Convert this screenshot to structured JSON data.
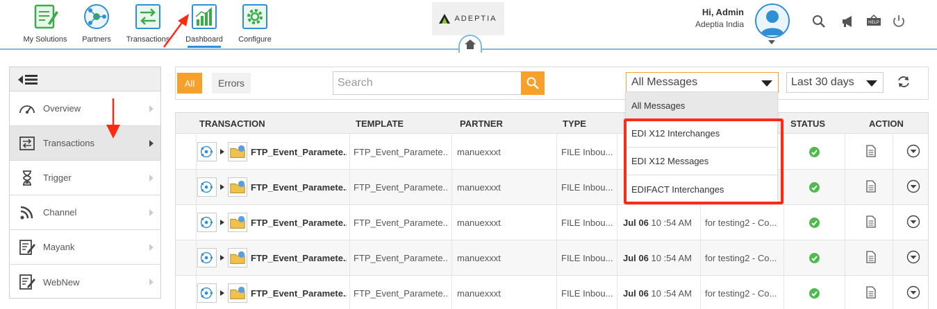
{
  "nav": {
    "items": [
      {
        "label": "My Solutions",
        "icon": "my-solutions-icon"
      },
      {
        "label": "Partners",
        "icon": "partners-icon"
      },
      {
        "label": "Transactions",
        "icon": "transactions-icon"
      },
      {
        "label": "Dashboard",
        "icon": "dashboard-icon"
      },
      {
        "label": "Configure",
        "icon": "configure-icon"
      }
    ],
    "active": "Dashboard"
  },
  "logo": {
    "text": "ADEPTIA"
  },
  "user": {
    "greeting": "Hi, Admin",
    "org": "Adeptia India"
  },
  "sidebar": {
    "items": [
      {
        "label": "Overview",
        "icon": "gauge-icon"
      },
      {
        "label": "Transactions",
        "icon": "transactions-icon"
      },
      {
        "label": "Trigger",
        "icon": "hourglass-icon"
      },
      {
        "label": "Channel",
        "icon": "rss-icon"
      },
      {
        "label": "Mayank",
        "icon": "edit-doc-icon"
      },
      {
        "label": "WebNew",
        "icon": "edit-doc-icon"
      }
    ],
    "active": "Transactions"
  },
  "filters": {
    "all_label": "All",
    "errors_label": "Errors",
    "search_placeholder": "Search",
    "message_select": "All Messages",
    "period_select": "Last 30 days"
  },
  "dropdown": {
    "items": [
      "All Messages",
      "EDI X12 Interchanges",
      "EDI X12 Messages",
      "EDIFACT Interchanges"
    ],
    "selected": "All Messages"
  },
  "table": {
    "headers": [
      "TRANSACTION",
      "TEMPLATE",
      "PARTNER",
      "TYPE",
      "",
      "",
      "STATUS",
      "ACTION"
    ],
    "rows": [
      {
        "transaction": "FTP_Event_Paramete...",
        "template": "FTP_Event_Paramete...",
        "partner": "manuexxxt",
        "type": "FILE Inbou...",
        "date_bold": "",
        "date_rest": "",
        "desc": ""
      },
      {
        "transaction": "FTP_Event_Paramete...",
        "template": "FTP_Event_Paramete...",
        "partner": "manuexxxt",
        "type": "FILE Inbou...",
        "date_bold": "",
        "date_rest": "",
        "desc": ""
      },
      {
        "transaction": "FTP_Event_Paramete...",
        "template": "FTP_Event_Paramete...",
        "partner": "manuexxxt",
        "type": "FILE Inbou...",
        "date_bold": "Jul 06",
        "date_rest": " 10 :54 AM",
        "desc": "for testing2 - Co..."
      },
      {
        "transaction": "FTP_Event_Paramete...",
        "template": "FTP_Event_Paramete...",
        "partner": "manuexxxt",
        "type": "FILE Inbou...",
        "date_bold": "Jul 06",
        "date_rest": " 10 :54 AM",
        "desc": "for testing2 - Co..."
      },
      {
        "transaction": "FTP_Event_Paramete...",
        "template": "FTP_Event_Paramete...",
        "partner": "manuexxxt",
        "type": "FILE Inbou...",
        "date_bold": "Jul 06",
        "date_rest": " 10 :54 AM",
        "desc": "for testing2 - Co..."
      }
    ]
  },
  "colors": {
    "accent": "#f7a02c",
    "brand_blue": "#2f8fd6",
    "annotation_red": "#ff2a16",
    "status_ok": "#4cbb4c"
  }
}
